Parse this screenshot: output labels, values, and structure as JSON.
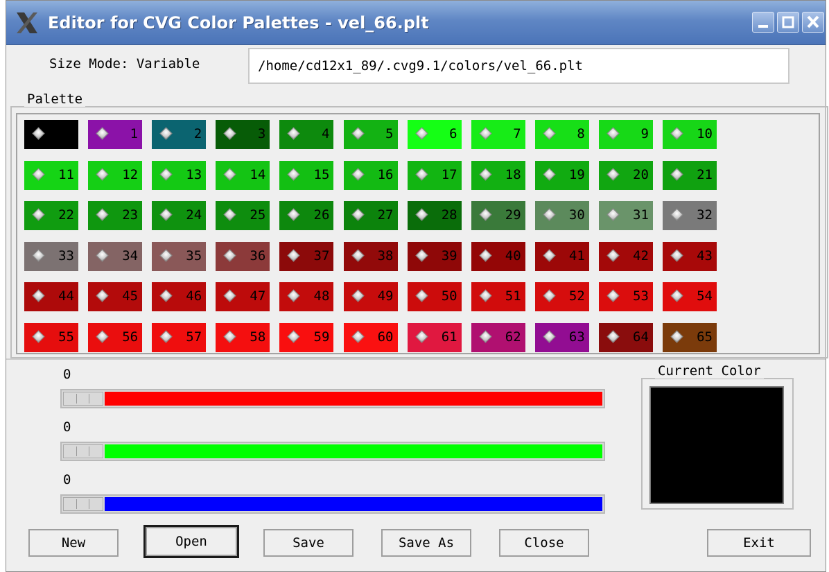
{
  "window": {
    "title": "Editor for CVG Color Palettes - vel_66.plt"
  },
  "icons": {
    "app": "x-logo-icon",
    "minimize": "minimize-icon",
    "maximize": "maximize-icon",
    "close": "close-icon"
  },
  "header": {
    "size_mode": "Size Mode: Variable",
    "path": "/home/cd12x1_89/.cvg9.1/colors/vel_66.plt"
  },
  "palette": {
    "label": "Palette",
    "swatches": [
      {
        "n": "",
        "c": "#000000"
      },
      {
        "n": "1",
        "c": "#8b12a8"
      },
      {
        "n": "2",
        "c": "#0b6470"
      },
      {
        "n": "3",
        "c": "#075c07"
      },
      {
        "n": "4",
        "c": "#0d8a0d"
      },
      {
        "n": "5",
        "c": "#13b213"
      },
      {
        "n": "6",
        "c": "#15ff15"
      },
      {
        "n": "7",
        "c": "#17ec17"
      },
      {
        "n": "8",
        "c": "#17df17"
      },
      {
        "n": "9",
        "c": "#17d917"
      },
      {
        "n": "10",
        "c": "#17d617"
      },
      {
        "n": "11",
        "c": "#15d415"
      },
      {
        "n": "12",
        "c": "#15cf15"
      },
      {
        "n": "13",
        "c": "#14c914"
      },
      {
        "n": "14",
        "c": "#14c414"
      },
      {
        "n": "15",
        "c": "#13bf13"
      },
      {
        "n": "16",
        "c": "#13ba13"
      },
      {
        "n": "17",
        "c": "#12b512"
      },
      {
        "n": "18",
        "c": "#12b012"
      },
      {
        "n": "19",
        "c": "#11ab11"
      },
      {
        "n": "20",
        "c": "#11a611"
      },
      {
        "n": "21",
        "c": "#10a110"
      },
      {
        "n": "22",
        "c": "#109c10"
      },
      {
        "n": "23",
        "c": "#0f970f"
      },
      {
        "n": "24",
        "c": "#0f920f"
      },
      {
        "n": "25",
        "c": "#0e8d0e"
      },
      {
        "n": "26",
        "c": "#0d880d"
      },
      {
        "n": "27",
        "c": "#0c830c"
      },
      {
        "n": "28",
        "c": "#0a6d0a"
      },
      {
        "n": "29",
        "c": "#3a7a3a"
      },
      {
        "n": "30",
        "c": "#5c8a5c"
      },
      {
        "n": "31",
        "c": "#6a946a"
      },
      {
        "n": "32",
        "c": "#7a7a7a"
      },
      {
        "n": "33",
        "c": "#7c7272"
      },
      {
        "n": "34",
        "c": "#846464"
      },
      {
        "n": "35",
        "c": "#8a5858"
      },
      {
        "n": "36",
        "c": "#8c3a3a"
      },
      {
        "n": "37",
        "c": "#8c0a0a"
      },
      {
        "n": "38",
        "c": "#920a0a"
      },
      {
        "n": "39",
        "c": "#8f0808"
      },
      {
        "n": "40",
        "c": "#940606"
      },
      {
        "n": "41",
        "c": "#9c0808"
      },
      {
        "n": "42",
        "c": "#a30909"
      },
      {
        "n": "43",
        "c": "#a80909"
      },
      {
        "n": "44",
        "c": "#ad0a0a"
      },
      {
        "n": "45",
        "c": "#b30b0b"
      },
      {
        "n": "46",
        "c": "#b80b0b"
      },
      {
        "n": "47",
        "c": "#bd0b0b"
      },
      {
        "n": "48",
        "c": "#c20c0c"
      },
      {
        "n": "49",
        "c": "#c70c0c"
      },
      {
        "n": "50",
        "c": "#cc0c0c"
      },
      {
        "n": "51",
        "c": "#d10c0c"
      },
      {
        "n": "52",
        "c": "#d60d0d"
      },
      {
        "n": "53",
        "c": "#db0d0d"
      },
      {
        "n": "54",
        "c": "#e00d0d"
      },
      {
        "n": "55",
        "c": "#e50e0e"
      },
      {
        "n": "56",
        "c": "#ea0e0e"
      },
      {
        "n": "57",
        "c": "#ef0e0e"
      },
      {
        "n": "58",
        "c": "#f40f0f"
      },
      {
        "n": "59",
        "c": "#f90f0f"
      },
      {
        "n": "60",
        "c": "#fa1111"
      },
      {
        "n": "61",
        "c": "#e01840"
      },
      {
        "n": "62",
        "c": "#b01070"
      },
      {
        "n": "63",
        "c": "#920d92"
      },
      {
        "n": "64",
        "c": "#8a0d0d"
      },
      {
        "n": "65",
        "c": "#7b3b0b"
      }
    ]
  },
  "sliders": [
    {
      "value": "0",
      "color": "#ff0000",
      "name": "red"
    },
    {
      "value": "0",
      "color": "#00ff00",
      "name": "green"
    },
    {
      "value": "0",
      "color": "#0000ff",
      "name": "blue"
    }
  ],
  "current_color": {
    "label": "Current Color",
    "color": "#000000"
  },
  "buttons": {
    "new": "New",
    "open": "Open",
    "save": "Save",
    "save_as": "Save As",
    "close": "Close",
    "exit": "Exit"
  }
}
